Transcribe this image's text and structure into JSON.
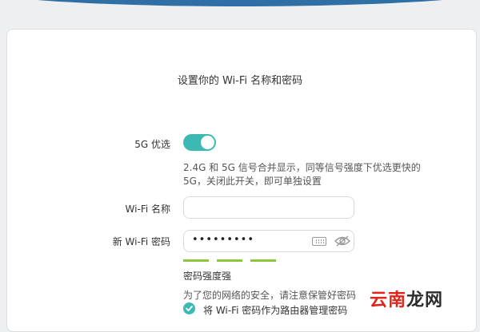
{
  "title": "设置你的 Wi-Fi 名称和密码",
  "five_g": {
    "label": "5G 优选",
    "enabled": true,
    "hint_line1": "2.4G 和 5G 信号合并显示，同等信号强度下优选更快的",
    "hint_line2": "5G，关闭此开关，即可单独设置"
  },
  "wifi_name": {
    "label": "Wi-Fi 名称",
    "value": ""
  },
  "wifi_password": {
    "label": "新 Wi-Fi 密码",
    "value": "•••••••••"
  },
  "strength": {
    "bars_filled": 3,
    "bars_total": 3,
    "text": "密码强度强",
    "color": "#8cc63f"
  },
  "security_note": "为了您的网络的安全，请注意保管好密码",
  "use_as_admin": {
    "checked": true,
    "label": "将 Wi-Fi 密码作为路由器管理密码"
  },
  "watermark": {
    "part1": "云南",
    "part2": "龙网"
  },
  "colors": {
    "accent": "#3bb9b2",
    "header": "#2f6fa6"
  }
}
